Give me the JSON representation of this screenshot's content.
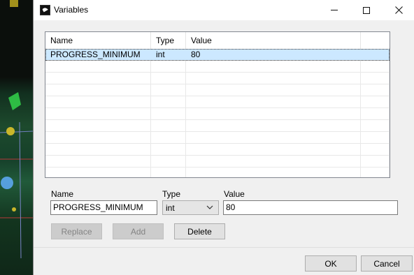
{
  "window": {
    "title": "Variables",
    "icon": "app-logo-icon",
    "controls": [
      "minimize-icon",
      "maximize-icon",
      "close-icon"
    ]
  },
  "listview": {
    "columns": [
      "Name",
      "Type",
      "Value"
    ],
    "rows": [
      {
        "name": "PROGRESS_MINIMUM",
        "type": "int",
        "value": "80",
        "selected": true
      }
    ],
    "selected_color": "#cce8ff"
  },
  "editor": {
    "name_label": "Name",
    "type_label": "Type",
    "value_label": "Value",
    "name_value": "PROGRESS_MINIMUM",
    "type_value": "int",
    "value_value": "80"
  },
  "actions": {
    "replace_label": "Replace",
    "add_label": "Add",
    "delete_label": "Delete"
  },
  "footer": {
    "ok_label": "OK",
    "cancel_label": "Cancel"
  }
}
